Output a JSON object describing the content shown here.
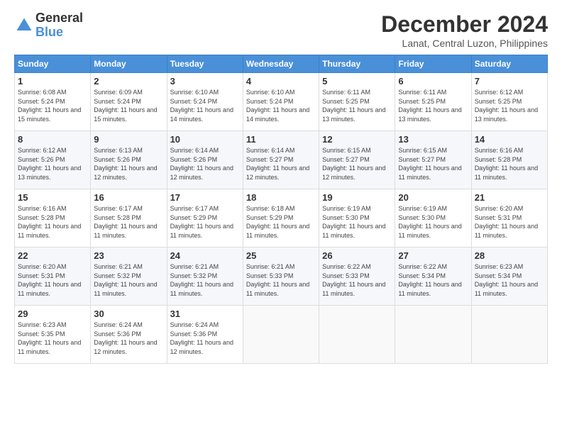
{
  "logo": {
    "general": "General",
    "blue": "Blue"
  },
  "title": "December 2024",
  "location": "Lanat, Central Luzon, Philippines",
  "headers": [
    "Sunday",
    "Monday",
    "Tuesday",
    "Wednesday",
    "Thursday",
    "Friday",
    "Saturday"
  ],
  "weeks": [
    [
      {
        "day": "1",
        "sunrise": "6:08 AM",
        "sunset": "5:24 PM",
        "daylight": "11 hours and 15 minutes."
      },
      {
        "day": "2",
        "sunrise": "6:09 AM",
        "sunset": "5:24 PM",
        "daylight": "11 hours and 15 minutes."
      },
      {
        "day": "3",
        "sunrise": "6:10 AM",
        "sunset": "5:24 PM",
        "daylight": "11 hours and 14 minutes."
      },
      {
        "day": "4",
        "sunrise": "6:10 AM",
        "sunset": "5:24 PM",
        "daylight": "11 hours and 14 minutes."
      },
      {
        "day": "5",
        "sunrise": "6:11 AM",
        "sunset": "5:25 PM",
        "daylight": "11 hours and 13 minutes."
      },
      {
        "day": "6",
        "sunrise": "6:11 AM",
        "sunset": "5:25 PM",
        "daylight": "11 hours and 13 minutes."
      },
      {
        "day": "7",
        "sunrise": "6:12 AM",
        "sunset": "5:25 PM",
        "daylight": "11 hours and 13 minutes."
      }
    ],
    [
      {
        "day": "8",
        "sunrise": "6:12 AM",
        "sunset": "5:26 PM",
        "daylight": "11 hours and 13 minutes."
      },
      {
        "day": "9",
        "sunrise": "6:13 AM",
        "sunset": "5:26 PM",
        "daylight": "11 hours and 12 minutes."
      },
      {
        "day": "10",
        "sunrise": "6:14 AM",
        "sunset": "5:26 PM",
        "daylight": "11 hours and 12 minutes."
      },
      {
        "day": "11",
        "sunrise": "6:14 AM",
        "sunset": "5:27 PM",
        "daylight": "11 hours and 12 minutes."
      },
      {
        "day": "12",
        "sunrise": "6:15 AM",
        "sunset": "5:27 PM",
        "daylight": "11 hours and 12 minutes."
      },
      {
        "day": "13",
        "sunrise": "6:15 AM",
        "sunset": "5:27 PM",
        "daylight": "11 hours and 11 minutes."
      },
      {
        "day": "14",
        "sunrise": "6:16 AM",
        "sunset": "5:28 PM",
        "daylight": "11 hours and 11 minutes."
      }
    ],
    [
      {
        "day": "15",
        "sunrise": "6:16 AM",
        "sunset": "5:28 PM",
        "daylight": "11 hours and 11 minutes."
      },
      {
        "day": "16",
        "sunrise": "6:17 AM",
        "sunset": "5:28 PM",
        "daylight": "11 hours and 11 minutes."
      },
      {
        "day": "17",
        "sunrise": "6:17 AM",
        "sunset": "5:29 PM",
        "daylight": "11 hours and 11 minutes."
      },
      {
        "day": "18",
        "sunrise": "6:18 AM",
        "sunset": "5:29 PM",
        "daylight": "11 hours and 11 minutes."
      },
      {
        "day": "19",
        "sunrise": "6:19 AM",
        "sunset": "5:30 PM",
        "daylight": "11 hours and 11 minutes."
      },
      {
        "day": "20",
        "sunrise": "6:19 AM",
        "sunset": "5:30 PM",
        "daylight": "11 hours and 11 minutes."
      },
      {
        "day": "21",
        "sunrise": "6:20 AM",
        "sunset": "5:31 PM",
        "daylight": "11 hours and 11 minutes."
      }
    ],
    [
      {
        "day": "22",
        "sunrise": "6:20 AM",
        "sunset": "5:31 PM",
        "daylight": "11 hours and 11 minutes."
      },
      {
        "day": "23",
        "sunrise": "6:21 AM",
        "sunset": "5:32 PM",
        "daylight": "11 hours and 11 minutes."
      },
      {
        "day": "24",
        "sunrise": "6:21 AM",
        "sunset": "5:32 PM",
        "daylight": "11 hours and 11 minutes."
      },
      {
        "day": "25",
        "sunrise": "6:21 AM",
        "sunset": "5:33 PM",
        "daylight": "11 hours and 11 minutes."
      },
      {
        "day": "26",
        "sunrise": "6:22 AM",
        "sunset": "5:33 PM",
        "daylight": "11 hours and 11 minutes."
      },
      {
        "day": "27",
        "sunrise": "6:22 AM",
        "sunset": "5:34 PM",
        "daylight": "11 hours and 11 minutes."
      },
      {
        "day": "28",
        "sunrise": "6:23 AM",
        "sunset": "5:34 PM",
        "daylight": "11 hours and 11 minutes."
      }
    ],
    [
      {
        "day": "29",
        "sunrise": "6:23 AM",
        "sunset": "5:35 PM",
        "daylight": "11 hours and 11 minutes."
      },
      {
        "day": "30",
        "sunrise": "6:24 AM",
        "sunset": "5:36 PM",
        "daylight": "11 hours and 12 minutes."
      },
      {
        "day": "31",
        "sunrise": "6:24 AM",
        "sunset": "5:36 PM",
        "daylight": "11 hours and 12 minutes."
      },
      null,
      null,
      null,
      null
    ]
  ]
}
